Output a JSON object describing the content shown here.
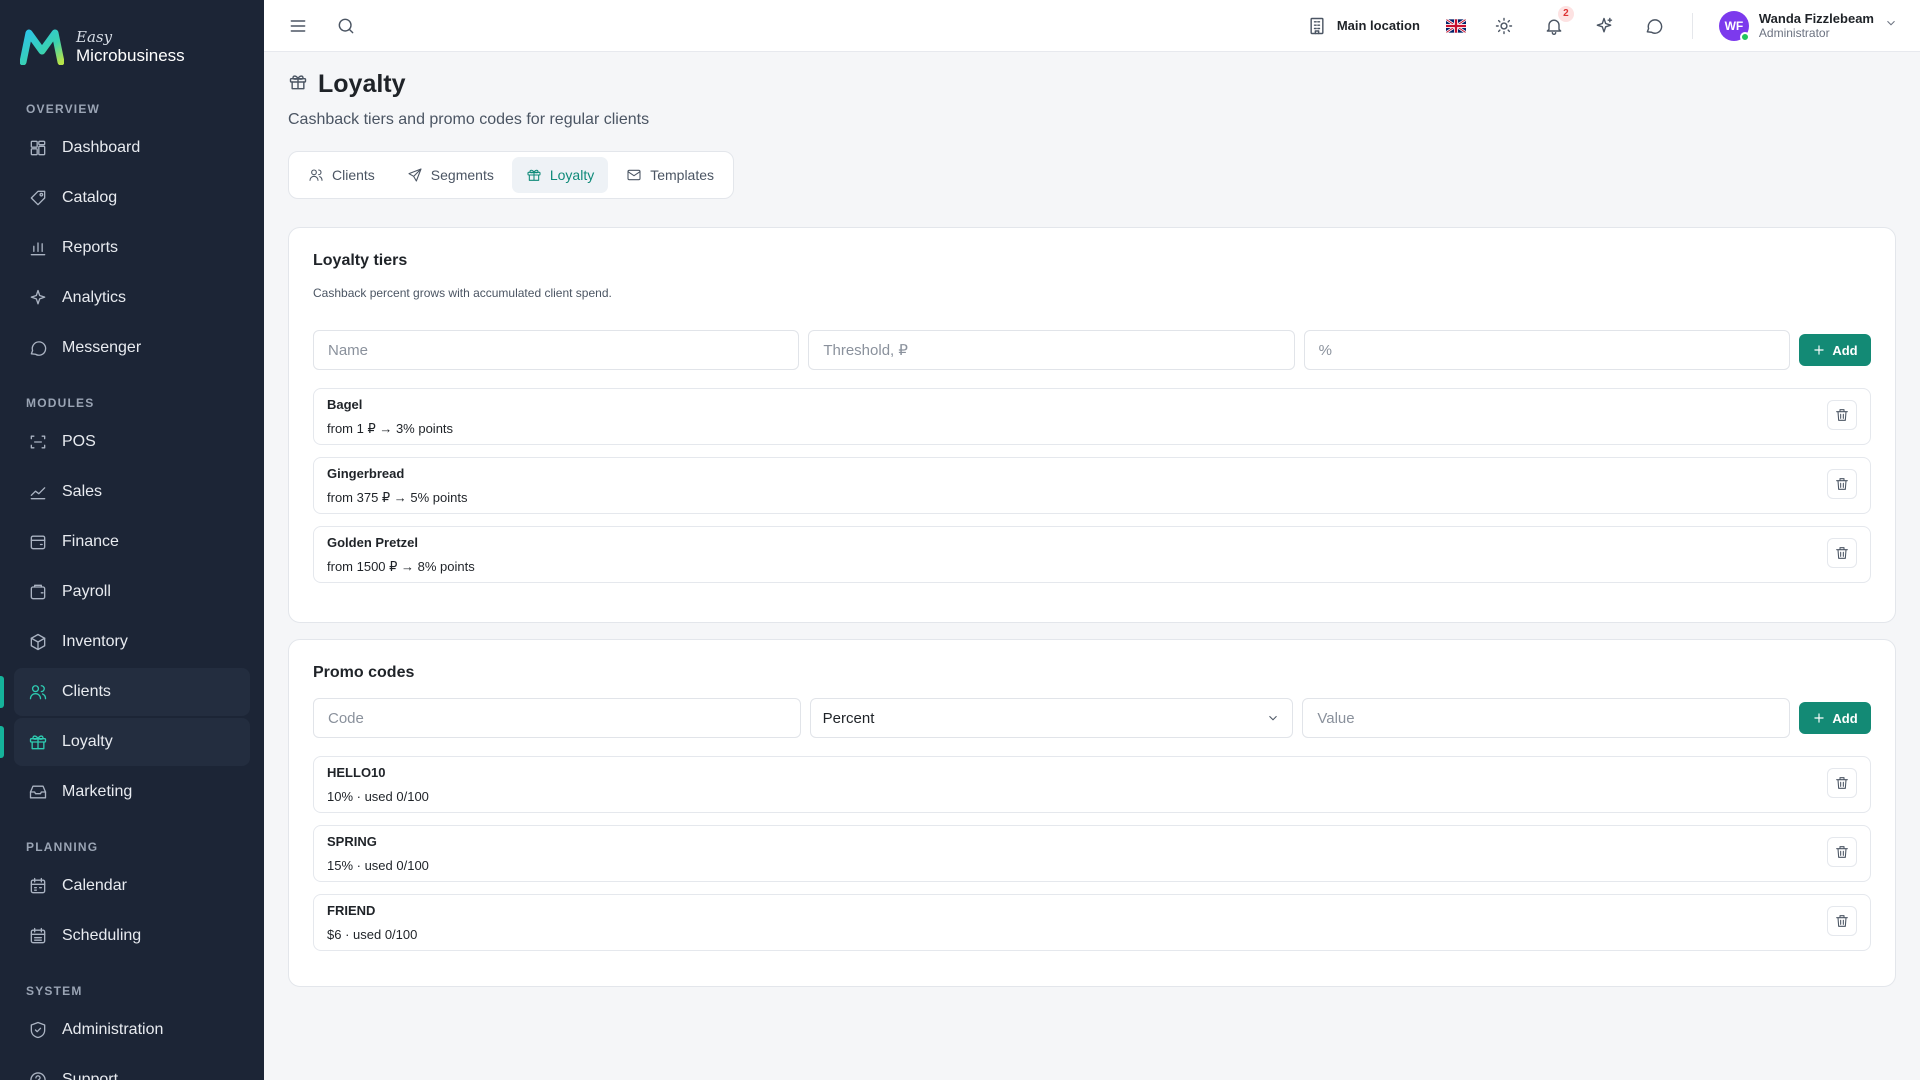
{
  "brand": {
    "easy": "Easy",
    "name": "Microbusiness"
  },
  "sidebar": {
    "sections": [
      {
        "label": "OVERVIEW",
        "items": [
          {
            "label": "Dashboard",
            "icon": "dashboard-icon"
          },
          {
            "label": "Catalog",
            "icon": "catalog-icon"
          },
          {
            "label": "Reports",
            "icon": "reports-icon"
          },
          {
            "label": "Analytics",
            "icon": "analytics-icon"
          },
          {
            "label": "Messenger",
            "icon": "messenger-icon"
          }
        ]
      },
      {
        "label": "MODULES",
        "items": [
          {
            "label": "POS",
            "icon": "pos-icon"
          },
          {
            "label": "Sales",
            "icon": "sales-icon"
          },
          {
            "label": "Finance",
            "icon": "finance-icon"
          },
          {
            "label": "Payroll",
            "icon": "payroll-icon"
          },
          {
            "label": "Inventory",
            "icon": "inventory-icon"
          },
          {
            "label": "Clients",
            "icon": "clients-icon",
            "active": true
          },
          {
            "label": "Loyalty",
            "icon": "loyalty-icon",
            "active": true
          },
          {
            "label": "Marketing",
            "icon": "marketing-icon"
          }
        ]
      },
      {
        "label": "PLANNING",
        "items": [
          {
            "label": "Calendar",
            "icon": "calendar-icon"
          },
          {
            "label": "Scheduling",
            "icon": "scheduling-icon"
          }
        ]
      },
      {
        "label": "SYSTEM",
        "items": [
          {
            "label": "Administration",
            "icon": "administration-icon"
          },
          {
            "label": "Support",
            "icon": "support-icon"
          }
        ]
      }
    ]
  },
  "topbar": {
    "location": "Main location",
    "notifications_count": "2",
    "user": {
      "initials": "WF",
      "name": "Wanda Fizzlebeam",
      "role": "Administrator"
    }
  },
  "page": {
    "title": "Loyalty",
    "subtitle": "Cashback tiers and promo codes for regular clients",
    "tabs": [
      {
        "label": "Clients",
        "icon": "users-icon"
      },
      {
        "label": "Segments",
        "icon": "send-icon"
      },
      {
        "label": "Loyalty",
        "icon": "gift-icon",
        "active": true
      },
      {
        "label": "Templates",
        "icon": "mail-icon"
      }
    ]
  },
  "tiers": {
    "title": "Loyalty tiers",
    "description": "Cashback percent grows with accumulated client spend.",
    "name_placeholder": "Name",
    "threshold_placeholder": "Threshold, ₽",
    "percent_placeholder": "%",
    "add_label": "Add",
    "items": [
      {
        "name": "Bagel",
        "detail": "from 1 ₽ → 3% points"
      },
      {
        "name": "Gingerbread",
        "detail": "from 375 ₽ → 5% points"
      },
      {
        "name": "Golden Pretzel",
        "detail": "from 1500 ₽ → 8% points"
      }
    ]
  },
  "promos": {
    "title": "Promo codes",
    "code_placeholder": "Code",
    "type_selected": "Percent",
    "value_placeholder": "Value",
    "add_label": "Add",
    "items": [
      {
        "name": "HELLO10",
        "detail": "10% · used 0/100"
      },
      {
        "name": "SPRING",
        "detail": "15% · used 0/100"
      },
      {
        "name": "FRIEND",
        "detail": "$6 · used 0/100"
      }
    ]
  },
  "colors": {
    "sidebar_bg": "#1c2536",
    "accent": "#138a75",
    "active_tab_text": "#0f8a79"
  }
}
